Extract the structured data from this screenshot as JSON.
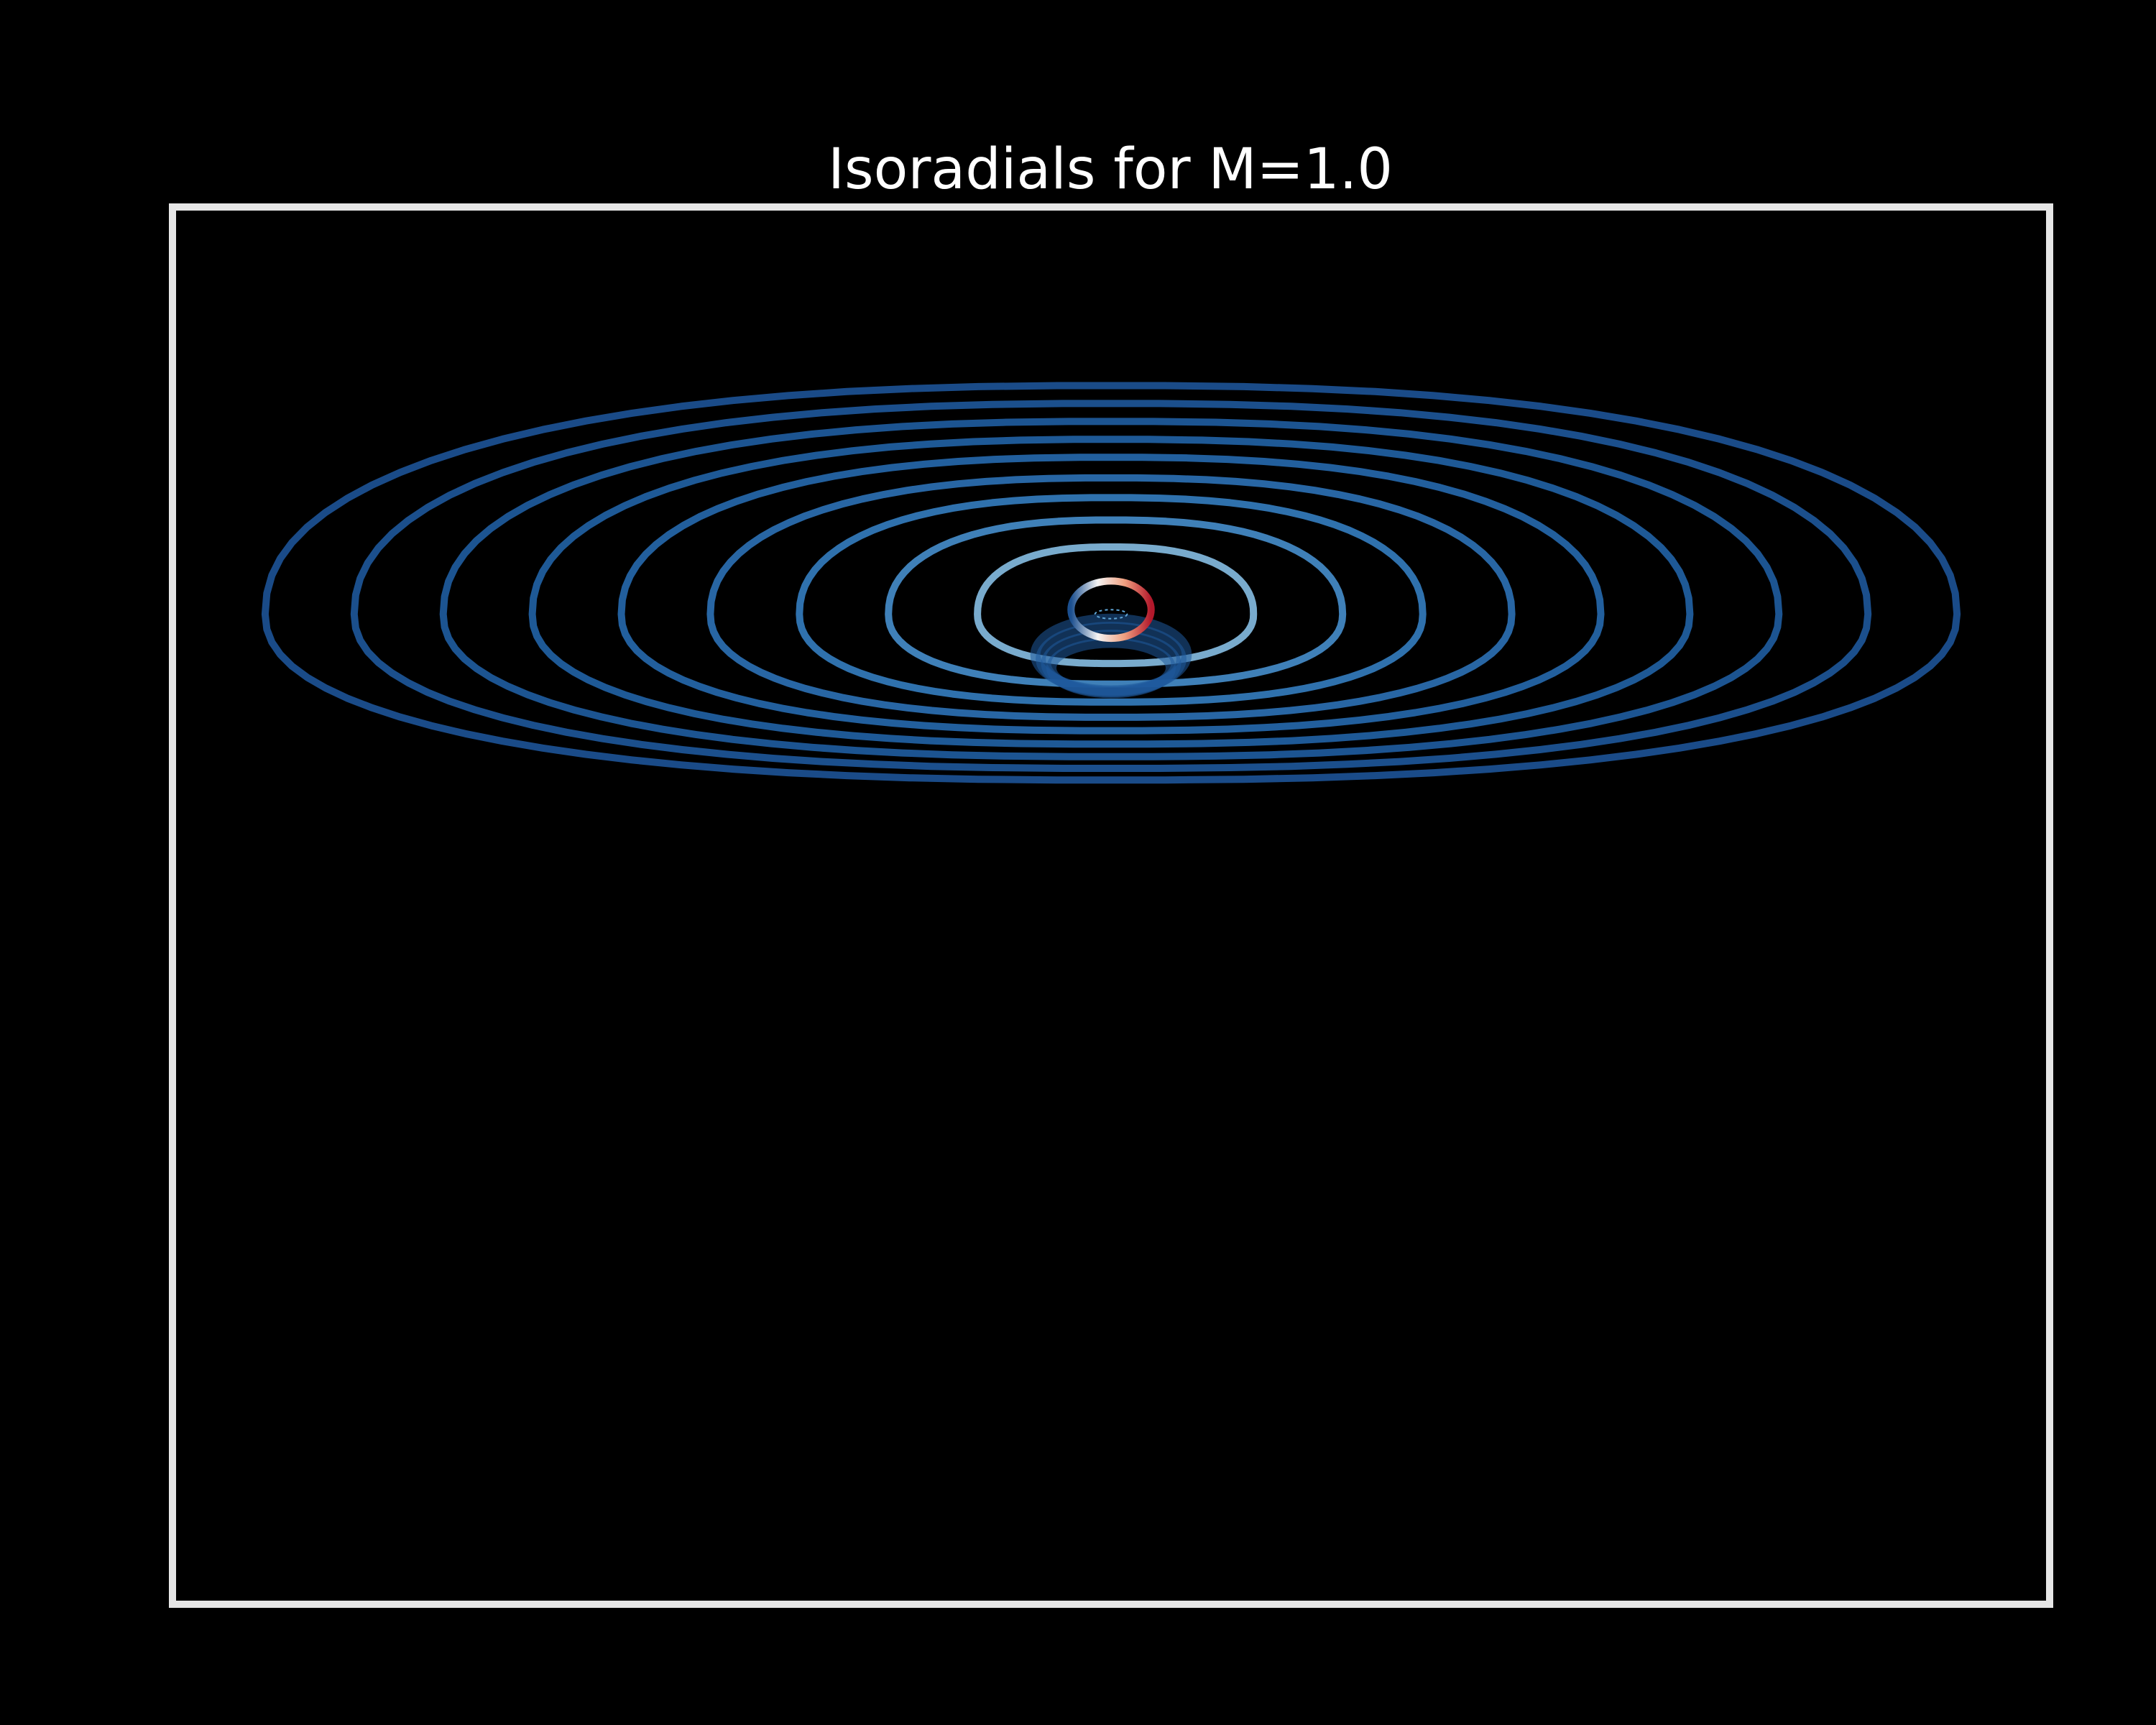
{
  "chart_data": {
    "type": "line",
    "title": "Isoradials for M=1.0",
    "xlabel": "",
    "ylabel": "",
    "axes_visible": false,
    "grid": false,
    "background": "#000000",
    "frame_color": "#e6e6e6",
    "colormap": "RdBu_r",
    "xlim": [
      -10.5,
      10.5
    ],
    "ylim": [
      -11,
      4.5
    ],
    "isoradials": [
      {
        "name": "",
        "left": 9.5,
        "right": 9.5,
        "top": 2.55,
        "bottom": 1.85,
        "color": "#1b4f8f"
      },
      {
        "name": "",
        "left": 8.5,
        "right": 8.5,
        "top": 2.35,
        "bottom": 1.72,
        "color": "#1c5394"
      },
      {
        "name": "",
        "left": 7.5,
        "right": 7.5,
        "top": 2.15,
        "bottom": 1.59,
        "color": "#1e5899"
      },
      {
        "name": "",
        "left": 6.5,
        "right": 6.5,
        "top": 1.95,
        "bottom": 1.45,
        "color": "#205e9e"
      },
      {
        "name": "",
        "left": 5.5,
        "right": 5.5,
        "top": 1.75,
        "bottom": 1.3,
        "color": "#2464a5"
      },
      {
        "name": "",
        "left": 4.5,
        "right": 4.5,
        "top": 1.52,
        "bottom": 1.15,
        "color": "#2a6cad"
      },
      {
        "name": "",
        "left": 3.5,
        "right": 3.5,
        "top": 1.3,
        "bottom": 0.98,
        "color": "#3277b6"
      },
      {
        "name": "",
        "left": 2.5,
        "right": 2.6,
        "top": 1.05,
        "bottom": 0.78,
        "color": "#4287c2"
      },
      {
        "name": "",
        "left": 1.5,
        "right": 1.6,
        "top": 0.75,
        "bottom": 0.55,
        "color": "#7fb4d8"
      }
    ],
    "photon_ring": {
      "center_x": 0.0,
      "center_y": 0.0,
      "rx": 0.45,
      "ry": 0.32,
      "colors": [
        "#1b4f8f",
        "#f4f4f4",
        "#f0a080",
        "#b2182b"
      ]
    },
    "ghost_images": {
      "center_x": 0.0,
      "center_y": -0.45,
      "rx": 0.85,
      "ry": 0.4,
      "count": 4,
      "color": "#1f5a9c"
    },
    "inner_marker": {
      "center_x": 0.0,
      "center_y": 0.0,
      "rx": 0.18,
      "ry": 0.05,
      "color": "#5fa5d6"
    }
  }
}
